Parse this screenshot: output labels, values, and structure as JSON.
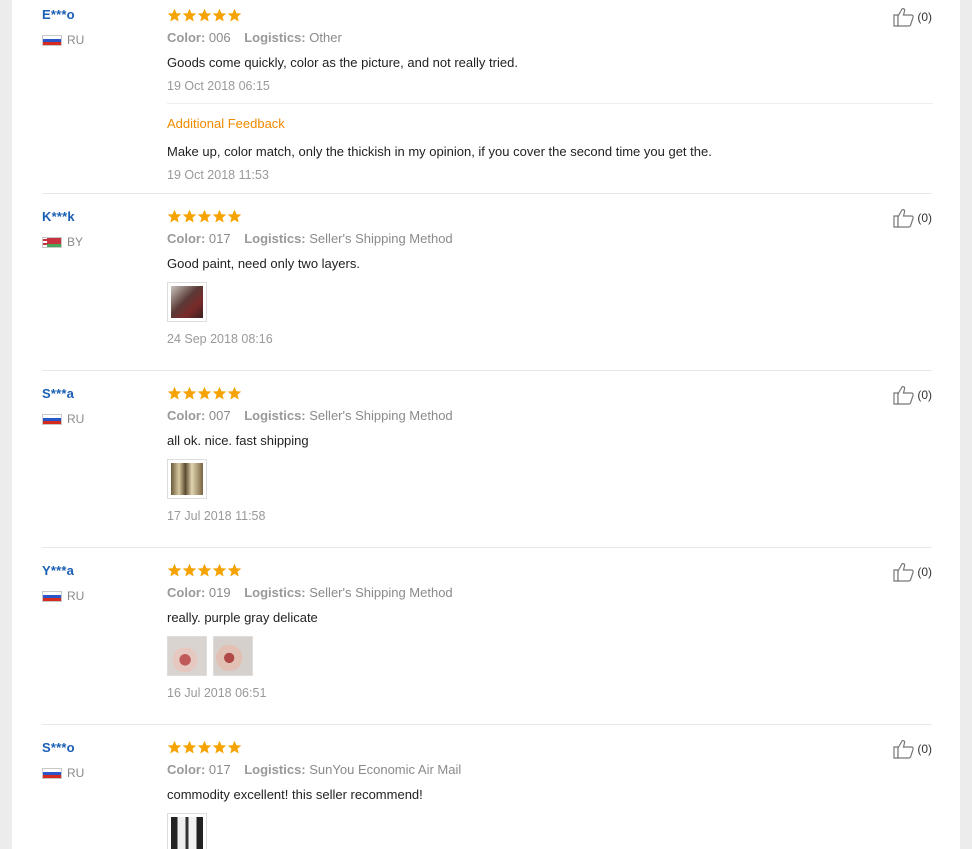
{
  "reviews": [
    {
      "user": "E***o",
      "country": "RU",
      "flag": "ru",
      "color_label": "Color:",
      "color": "006",
      "logistics_label": "Logistics:",
      "logistics": "Other",
      "text": "Goods come quickly, color as the picture, and not really tried.",
      "date": "19 Oct 2018 06:15",
      "likes": "(0)",
      "photos": [],
      "additional": {
        "title": "Additional Feedback",
        "text": "Make up, color match, only the thickish in my opinion, if you cover the second time you get the.",
        "date": "19 Oct 2018 11:53"
      }
    },
    {
      "user": "K***k",
      "country": "BY",
      "flag": "by",
      "color_label": "Color:",
      "color": "017",
      "logistics_label": "Logistics:",
      "logistics": "Seller's Shipping Method",
      "text": "Good paint, need only two layers.",
      "date": "24 Sep 2018 08:16",
      "likes": "(0)",
      "photos": [
        "nail-photo"
      ]
    },
    {
      "user": "S***a",
      "country": "RU",
      "flag": "ru",
      "color_label": "Color:",
      "color": "007",
      "logistics_label": "Logistics:",
      "logistics": "Seller's Shipping Method",
      "text": "all ok. nice. fast shipping",
      "date": "17 Jul 2018 11:58",
      "likes": "(0)",
      "photos": [
        "nail-photo"
      ]
    },
    {
      "user": "Y***a",
      "country": "RU",
      "flag": "ru",
      "color_label": "Color:",
      "color": "019",
      "logistics_label": "Logistics:",
      "logistics": "Seller's Shipping Method",
      "text": "really. purple gray delicate",
      "date": "16 Jul 2018 06:51",
      "likes": "(0)",
      "photos": [
        "nail-photo",
        "nail-photo"
      ]
    },
    {
      "user": "S***o",
      "country": "RU",
      "flag": "ru",
      "color_label": "Color:",
      "color": "017",
      "logistics_label": "Logistics:",
      "logistics": "SunYou Economic Air Mail",
      "text": "commodity excellent! this seller recommend!",
      "date": "",
      "likes": "(0)",
      "photos": [
        "nail-photo"
      ]
    }
  ],
  "rating_stars": 5,
  "colors": {
    "user_link": "#1a5fb4",
    "star": "#f5a300",
    "additional_title": "#f08a00",
    "muted": "#999999"
  }
}
